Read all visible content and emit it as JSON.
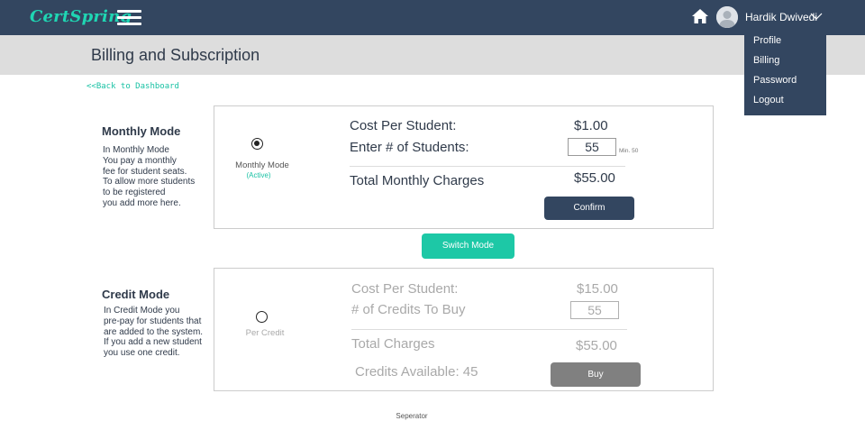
{
  "header": {
    "logo": "CertSpring",
    "user_name": "Hardik Dwivedi",
    "icons": {
      "menu": "hamburger-icon",
      "home": "home-icon",
      "avatar": "user-avatar-icon",
      "user_menu": "chevron-down-icon"
    }
  },
  "user_menu": {
    "items": [
      "Profile",
      "Billing",
      "Password",
      "Logout"
    ]
  },
  "page": {
    "title": "Billing and Subscription",
    "back_link": "<<Back to Dashboard"
  },
  "monthly": {
    "title": "Monthly Mode",
    "description": [
      "In Monthly Mode",
      "You pay a monthly",
      "fee for student seats.",
      "To allow more students",
      "to be registered",
      "you add more here."
    ],
    "mode_label": "Monthly Mode",
    "mode_status": "(Active)",
    "cost_label": "Cost Per Student:",
    "cost_value": "$1.00",
    "students_label": "Enter # of Students:",
    "students_value": "55",
    "min_note": "Min. 50",
    "total_label": "Total Monthly Charges",
    "total_value": "$55.00",
    "confirm_label": "Confirm"
  },
  "switch_label": "Switch Mode",
  "credit": {
    "title": "Credit Mode",
    "description": [
      "In Credit Mode you",
      "pre-pay for students that",
      "are added to the system.",
      "If you add a new student",
      "you use one credit."
    ],
    "mode_label": "Per Credit",
    "cost_label": "Cost Per Student:",
    "cost_value": "$15.00",
    "credits_label": "# of Credits To Buy",
    "credits_value": "55",
    "total_label": "Total Charges",
    "total_value": "$55.00",
    "available_label": "Credits Available: 45",
    "buy_label": "Buy"
  },
  "separator": "Seperator",
  "colors": {
    "navbar": "#334660",
    "accent": "#1dc8a6",
    "title_bar": "#dddddd",
    "buy_button": "#808080"
  }
}
